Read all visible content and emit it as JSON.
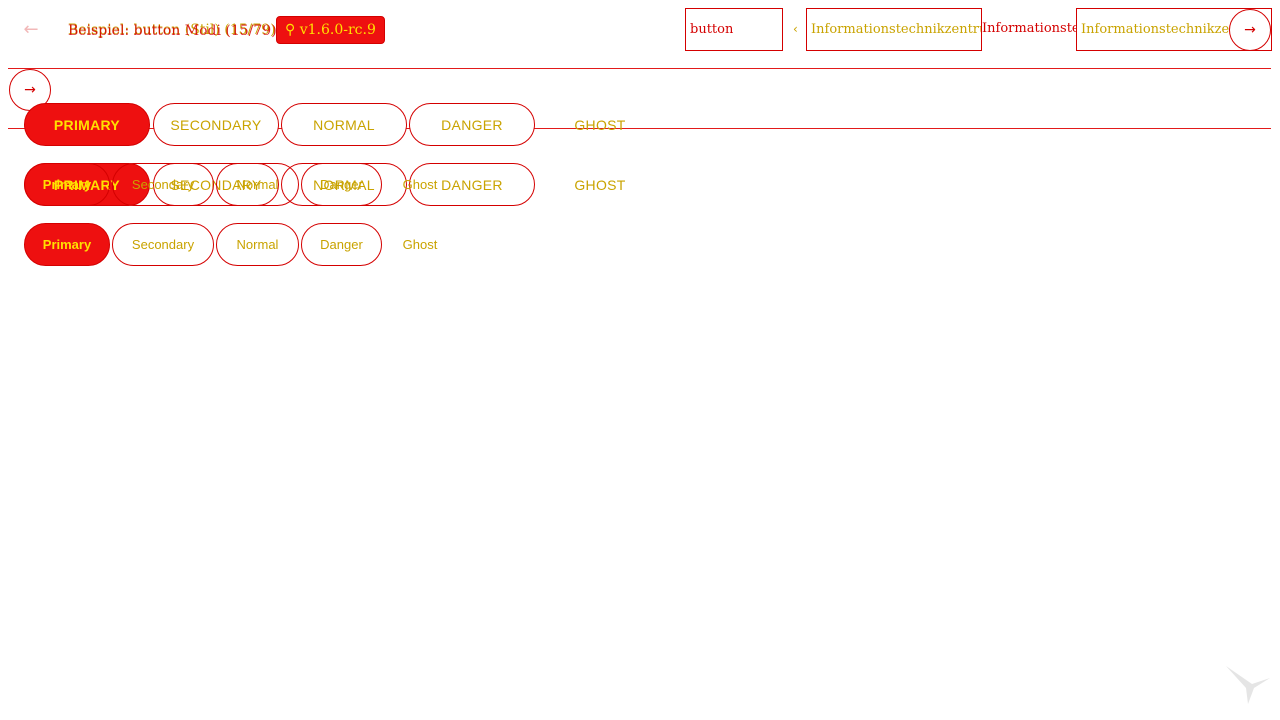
{
  "header": {
    "back_icon": "arrow-left-icon",
    "title_a": "Beispiel: button (Stil) (15/79)",
    "title_b": "Beispiel: button Modi (15/79)",
    "version": "⚲ v1.6.0-rc.9",
    "search": {
      "value": "button",
      "placeholder": ""
    },
    "org_left": "Informationstechnikzentrum Bund",
    "org_middle": "Informationstechnikzentrum Bund",
    "org_right": "Informationstechnikzentrum Bund",
    "chevron": "‹",
    "top_right_icon": "arrow-right-icon"
  },
  "side": {
    "icon": "arrow-right-icon"
  },
  "rows": {
    "caps": [
      "PRIMARY",
      "SECONDARY",
      "NORMAL",
      "DANGER",
      "GHOST"
    ],
    "normal": [
      "Primary",
      "Secondary",
      "Normal",
      "Danger",
      "Ghost"
    ]
  },
  "colors": {
    "accent": "#ee1010",
    "border": "#d40000",
    "label": "#c9a300",
    "primary_text": "#ffe000"
  }
}
